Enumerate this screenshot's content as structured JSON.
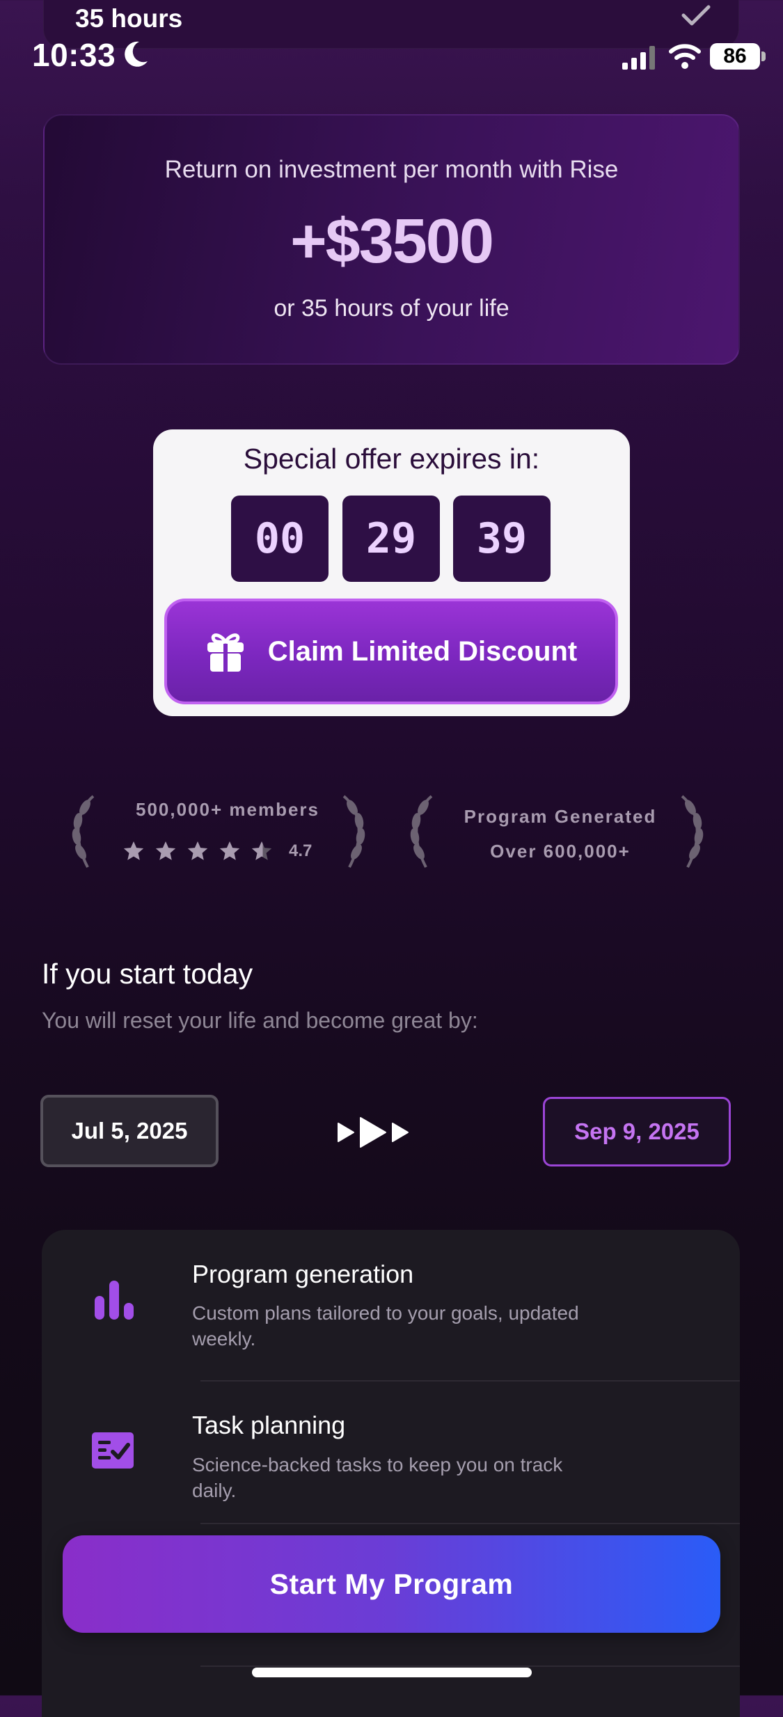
{
  "top_card": {
    "label": "35 hours"
  },
  "status_bar": {
    "time": "10:33",
    "battery": "86"
  },
  "roi": {
    "title": "Return on investment per month with Rise",
    "amount": "+$3500",
    "subtitle": "or 35 hours of your life"
  },
  "offer": {
    "title": "Special offer expires in:",
    "timer": [
      "00",
      "29",
      "39"
    ],
    "claim_label": "Claim Limited Discount"
  },
  "badges": {
    "members": "500,000+ members",
    "rating": "4.7",
    "program_line1": "Program Generated",
    "program_line2": "Over 600,000+"
  },
  "start_today": {
    "title": "If you start today",
    "subtitle": "You will reset your life and become great by:"
  },
  "dates": {
    "start": "Jul 5, 2025",
    "end": "Sep 9, 2025"
  },
  "features": [
    {
      "icon": "bar-chart-icon",
      "title": "Program generation",
      "desc": "Custom plans tailored to your goals, updated weekly."
    },
    {
      "icon": "task-list-icon",
      "title": "Task planning",
      "desc": "Science-backed tasks to keep you on track daily."
    }
  ],
  "cta": {
    "label": "Start My Program"
  },
  "colors": {
    "accent": "#9b3fd6",
    "cta_end": "#2a5cf7",
    "date_highlight": "#c574f2"
  }
}
